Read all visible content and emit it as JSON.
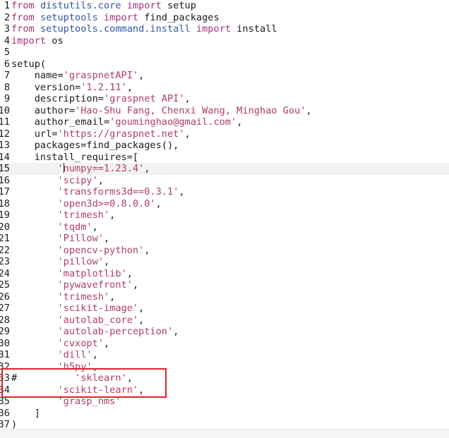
{
  "lines": [
    {
      "n": "1",
      "parts": [
        [
          "kw",
          "from"
        ],
        [
          "p",
          " "
        ],
        [
          "mod",
          "distutils.core"
        ],
        [
          "p",
          " "
        ],
        [
          "kw",
          "import"
        ],
        [
          "p",
          " setup"
        ]
      ]
    },
    {
      "n": "2",
      "parts": [
        [
          "kw",
          "from"
        ],
        [
          "p",
          " "
        ],
        [
          "mod",
          "setuptools"
        ],
        [
          "p",
          " "
        ],
        [
          "kw",
          "import"
        ],
        [
          "p",
          " find_packages"
        ]
      ]
    },
    {
      "n": "3",
      "parts": [
        [
          "kw",
          "from"
        ],
        [
          "p",
          " "
        ],
        [
          "mod",
          "setuptools.command.install"
        ],
        [
          "p",
          " "
        ],
        [
          "kw",
          "import"
        ],
        [
          "p",
          " install"
        ]
      ]
    },
    {
      "n": "4",
      "parts": [
        [
          "kw",
          "import"
        ],
        [
          "p",
          " os"
        ]
      ]
    },
    {
      "n": "5",
      "parts": []
    },
    {
      "n": "6",
      "parts": [
        [
          "p",
          "setup("
        ]
      ]
    },
    {
      "n": "7",
      "parts": [
        [
          "p",
          "    name="
        ],
        [
          "str",
          "'graspnetAPI'"
        ],
        [
          "p",
          ","
        ]
      ]
    },
    {
      "n": "8",
      "parts": [
        [
          "p",
          "    version="
        ],
        [
          "str",
          "'1.2.11'"
        ],
        [
          "p",
          ","
        ]
      ]
    },
    {
      "n": "9",
      "parts": [
        [
          "p",
          "    description="
        ],
        [
          "str",
          "'graspnet API'"
        ],
        [
          "p",
          ","
        ]
      ]
    },
    {
      "n": "10",
      "parts": [
        [
          "p",
          "    author="
        ],
        [
          "str",
          "'Hao-Shu Fang, Chenxi Wang, Minghao Gou'"
        ],
        [
          "p",
          ","
        ]
      ]
    },
    {
      "n": "11",
      "parts": [
        [
          "p",
          "    author_email="
        ],
        [
          "str",
          "'gouminghao@gmail.com'"
        ],
        [
          "p",
          ","
        ]
      ]
    },
    {
      "n": "12",
      "parts": [
        [
          "p",
          "    url="
        ],
        [
          "str",
          "'https://graspnet.net'"
        ],
        [
          "p",
          ","
        ]
      ]
    },
    {
      "n": "13",
      "parts": [
        [
          "p",
          "    packages=find_packages(),"
        ]
      ]
    },
    {
      "n": "14",
      "parts": [
        [
          "p",
          "    install_requires=["
        ]
      ]
    },
    {
      "n": "15",
      "current": true,
      "parts": [
        [
          "p",
          "        "
        ],
        [
          "str",
          "'"
        ],
        [
          "cursor",
          ""
        ],
        [
          "str",
          "numpy==1.23.4'"
        ],
        [
          "p",
          ","
        ]
      ]
    },
    {
      "n": "16",
      "parts": [
        [
          "p",
          "        "
        ],
        [
          "str",
          "'scipy'"
        ],
        [
          "p",
          ","
        ]
      ]
    },
    {
      "n": "17",
      "parts": [
        [
          "p",
          "        "
        ],
        [
          "str",
          "'transforms3d==0.3.1'"
        ],
        [
          "p",
          ","
        ]
      ]
    },
    {
      "n": "18",
      "parts": [
        [
          "p",
          "        "
        ],
        [
          "str",
          "'open3d>=0.8.0.0'"
        ],
        [
          "p",
          ","
        ]
      ]
    },
    {
      "n": "19",
      "parts": [
        [
          "p",
          "        "
        ],
        [
          "str",
          "'trimesh'"
        ],
        [
          "p",
          ","
        ]
      ]
    },
    {
      "n": "20",
      "parts": [
        [
          "p",
          "        "
        ],
        [
          "str",
          "'tqdm'"
        ],
        [
          "p",
          ","
        ]
      ]
    },
    {
      "n": "21",
      "parts": [
        [
          "p",
          "        "
        ],
        [
          "str",
          "'Pillow'"
        ],
        [
          "p",
          ","
        ]
      ]
    },
    {
      "n": "22",
      "parts": [
        [
          "p",
          "        "
        ],
        [
          "str",
          "'opencv-python'"
        ],
        [
          "p",
          ","
        ]
      ]
    },
    {
      "n": "23",
      "parts": [
        [
          "p",
          "        "
        ],
        [
          "str",
          "'pillow'"
        ],
        [
          "p",
          ","
        ]
      ]
    },
    {
      "n": "24",
      "parts": [
        [
          "p",
          "        "
        ],
        [
          "str",
          "'matplotlib'"
        ],
        [
          "p",
          ","
        ]
      ]
    },
    {
      "n": "25",
      "parts": [
        [
          "p",
          "        "
        ],
        [
          "str",
          "'pywavefront'"
        ],
        [
          "p",
          ","
        ]
      ]
    },
    {
      "n": "26",
      "parts": [
        [
          "p",
          "        "
        ],
        [
          "str",
          "'trimesh'"
        ],
        [
          "p",
          ","
        ]
      ]
    },
    {
      "n": "27",
      "parts": [
        [
          "p",
          "        "
        ],
        [
          "str",
          "'scikit-image'"
        ],
        [
          "p",
          ","
        ]
      ]
    },
    {
      "n": "28",
      "parts": [
        [
          "p",
          "        "
        ],
        [
          "str",
          "'autolab_core'"
        ],
        [
          "p",
          ","
        ]
      ]
    },
    {
      "n": "29",
      "parts": [
        [
          "p",
          "        "
        ],
        [
          "str",
          "'autolab-perception'"
        ],
        [
          "p",
          ","
        ]
      ]
    },
    {
      "n": "30",
      "parts": [
        [
          "p",
          "        "
        ],
        [
          "str",
          "'cvxopt'"
        ],
        [
          "p",
          ","
        ]
      ]
    },
    {
      "n": "31",
      "parts": [
        [
          "p",
          "        "
        ],
        [
          "str",
          "'dill'"
        ],
        [
          "p",
          ","
        ]
      ]
    },
    {
      "n": "32",
      "parts": [
        [
          "p",
          "        "
        ],
        [
          "str",
          "'h5py'"
        ],
        [
          "p",
          ","
        ]
      ]
    },
    {
      "n": "33",
      "parts": [
        [
          "p",
          "#          "
        ],
        [
          "str",
          "'sklearn'"
        ],
        [
          "p",
          ","
        ]
      ]
    },
    {
      "n": "34",
      "parts": [
        [
          "p",
          "        "
        ],
        [
          "str",
          "'scikit-learn'"
        ],
        [
          "p",
          ","
        ]
      ]
    },
    {
      "n": "35",
      "parts": [
        [
          "p",
          "        "
        ],
        [
          "str",
          "'grasp_nms'"
        ]
      ]
    },
    {
      "n": "36",
      "parts": [
        [
          "p",
          "    ]"
        ]
      ]
    },
    {
      "n": "37",
      "parts": [
        [
          "p",
          ")"
        ]
      ]
    }
  ],
  "colors": {
    "keyword": "#a4337b",
    "module": "#3355aa",
    "string": "#b03c6a",
    "highlight_box": "#e0202a",
    "current_line": "#f2f2f2"
  }
}
